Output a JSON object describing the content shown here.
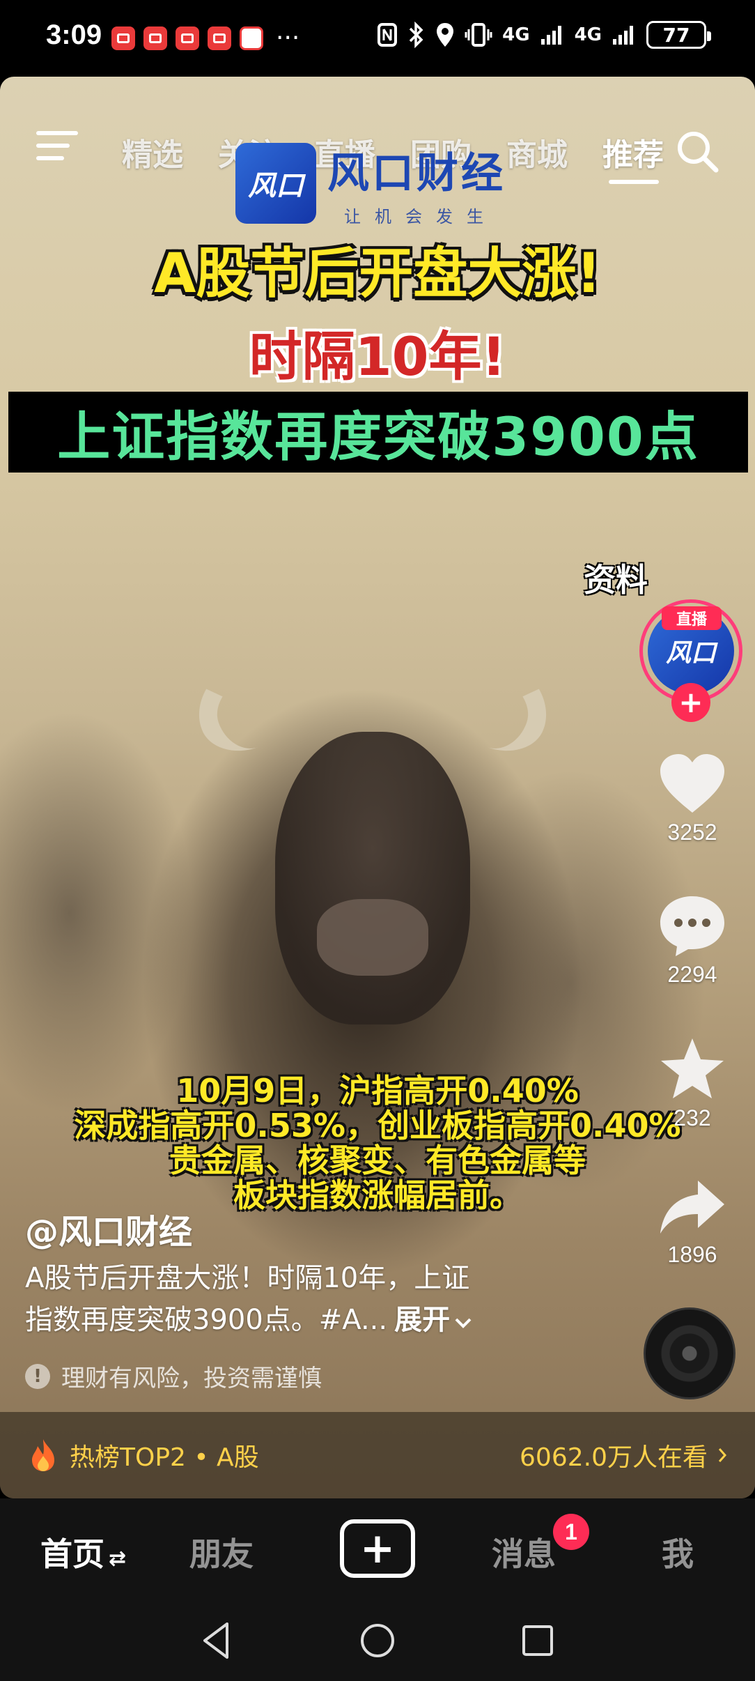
{
  "status_bar": {
    "time": "3:09",
    "more": "···",
    "net1": "4G",
    "net2": "4G",
    "battery": "77"
  },
  "top_nav": {
    "tabs": [
      "精选",
      "关注",
      "直播",
      "团购",
      "商城",
      "推荐"
    ],
    "active_tab": "推荐"
  },
  "video": {
    "brand_name": "风口财经",
    "brand_slogan": "让机会发生",
    "brand_logo_text": "风口",
    "headline1": "A股节后开盘大涨!",
    "headline2": "时隔10年!",
    "headline3": "上证指数再度突破3900点",
    "caption_lines": [
      "10月9日，沪指高开0.40%",
      "深成指高开0.53%，创业板指高开0.40%",
      "贵金属、核聚变、有色金属等",
      "板块指数涨幅居前。"
    ]
  },
  "right_rail": {
    "info_label": "资料",
    "live_tag": "直播",
    "follow": "+",
    "likes": "3252",
    "comments": "2294",
    "favorites": "232",
    "shares": "1896"
  },
  "post": {
    "author": "@风口财经",
    "description_line1": "A股节后开盘大涨！时隔10年，上证",
    "description_line2": "指数再度突破3900点。#A...",
    "expand": "展开",
    "risk_notice": "理财有风险，投资需谨慎"
  },
  "hot_bar": {
    "rank_text": "热榜TOP2 • A股",
    "watching": "6062.0万人在看"
  },
  "tab_bar": {
    "home": "首页",
    "friends": "朋友",
    "create": "+",
    "messages": "消息",
    "message_badge": "1",
    "me": "我"
  },
  "colors": {
    "accent": "#fe2c55",
    "headline_yellow": "#ffe927",
    "headline_red": "#d32727",
    "headline_green": "#58e59a",
    "hot_gold": "#ffd14a"
  }
}
